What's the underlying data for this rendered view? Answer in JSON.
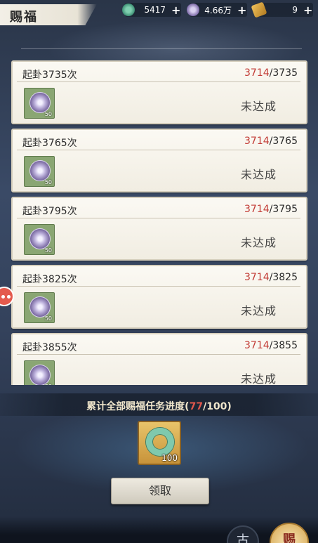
{
  "header": {
    "title": "赐福",
    "resources": [
      {
        "icon": "jade-icon",
        "value": "5417",
        "plus": "+"
      },
      {
        "icon": "coin-icon",
        "value": "4.66万",
        "plus": "+"
      },
      {
        "icon": "ticket-icon",
        "value": "9",
        "plus": "+"
      }
    ]
  },
  "tasks": [
    {
      "title": "起卦3735次",
      "current": "3714",
      "sep": "/",
      "target": "3735",
      "reward_qty": "50",
      "status": "未达成"
    },
    {
      "title": "起卦3765次",
      "current": "3714",
      "sep": "/",
      "target": "3765",
      "reward_qty": "50",
      "status": "未达成"
    },
    {
      "title": "起卦3795次",
      "current": "3714",
      "sep": "/",
      "target": "3795",
      "reward_qty": "50",
      "status": "未达成"
    },
    {
      "title": "起卦3825次",
      "current": "3714",
      "sep": "/",
      "target": "3825",
      "reward_qty": "50",
      "status": "未达成"
    },
    {
      "title": "起卦3855次",
      "current": "3714",
      "sep": "/",
      "target": "3855",
      "reward_qty": "50",
      "status": "未达成"
    }
  ],
  "cumulative": {
    "label_prefix": "累计全部赐福任务进度(",
    "current": "77",
    "sep": "/",
    "target": "100",
    "label_suffix": ")",
    "reward_qty": "100"
  },
  "claim_button": "领取",
  "corner_buttons": [
    "古",
    "赐"
  ]
}
